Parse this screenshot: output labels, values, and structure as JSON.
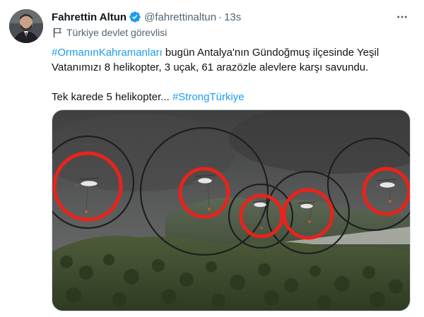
{
  "author": {
    "display_name": "Fahrettin Altun",
    "handle": "@fahrettinaltun",
    "separator": "·",
    "time": "13s",
    "verified_icon": "verified-badge-icon",
    "label": "Türkiye devlet görevlisi",
    "label_icon": "flag-icon"
  },
  "tweet": {
    "hashtag1": "#OrmanınKahramanları",
    "line1": " bugün Antalya'nın Gündoğmuş ilçesinde Yeşil",
    "line2": "Vatanımızı 8 helikopter, 3 uçak, 61 arazözle alevlere karşı savundu.",
    "line3": "Tek karede 5 helikopter... ",
    "hashtag2": "#StrongTürkiye"
  },
  "colors": {
    "accent": "#1d9bf0",
    "secondary_text": "#536471",
    "primary_text": "#0f1419",
    "highlight_ring": "#e8231c"
  },
  "menu": {
    "more_icon": "more-options-icon"
  },
  "media": {
    "description_icon": "photo",
    "highlighted_helicopters": 5
  }
}
